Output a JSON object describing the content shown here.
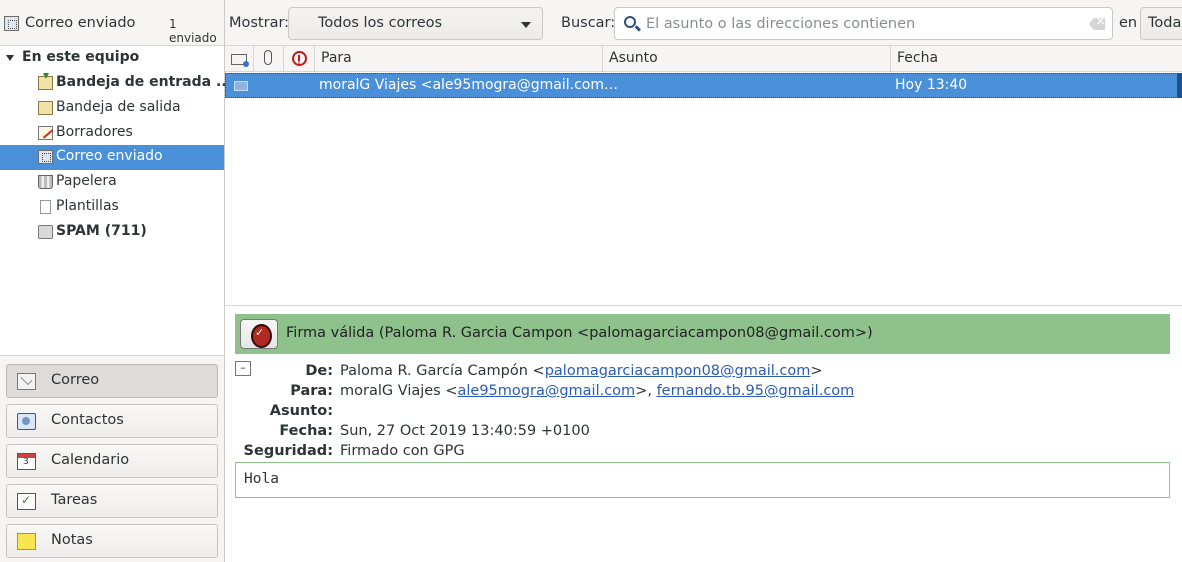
{
  "toolbar": {
    "folder_title": "Correo enviado",
    "folder_count": "1 enviado",
    "show_label": "Mostrar:",
    "show_value": "Todos los correos",
    "search_label": "Buscar:",
    "search_placeholder": "El asunto o las direcciones contienen",
    "in_label": "en",
    "scope_value": "Toda"
  },
  "sidebar": {
    "root_label": "En este equipo",
    "folders": [
      {
        "label": "Bandeja de entrada ...",
        "icon": "inbox-icon"
      },
      {
        "label": "Bandeja de salida",
        "icon": "outbox-icon"
      },
      {
        "label": "Borradores",
        "icon": "drafts-icon"
      },
      {
        "label": "Correo enviado",
        "icon": "sent-icon"
      },
      {
        "label": "Papelera",
        "icon": "trash-icon"
      },
      {
        "label": "Plantillas",
        "icon": "templates-icon"
      },
      {
        "label": "SPAM (711)",
        "icon": "spam-icon"
      }
    ]
  },
  "nav": {
    "items": [
      {
        "label": "Correo",
        "icon": "mail-icon"
      },
      {
        "label": "Contactos",
        "icon": "contacts-icon"
      },
      {
        "label": "Calendario",
        "icon": "calendar-icon"
      },
      {
        "label": "Tareas",
        "icon": "tasks-icon"
      },
      {
        "label": "Notas",
        "icon": "notes-icon"
      }
    ]
  },
  "list": {
    "columns": [
      "Para",
      "Asunto",
      "Fecha"
    ],
    "rows": [
      {
        "to": "moralG Viajes <ale95mogra@gmail.com…",
        "subject": "",
        "date": "Hoy 13:40"
      }
    ]
  },
  "preview": {
    "signature": "Firma válida (Paloma R. Garcia Campon <palomagarciacampon08@gmail.com>)",
    "collapse_symbol": "–",
    "from_label": "De:",
    "from_name": "Paloma R. García Campón <",
    "from_email": "palomagarciacampon08@gmail.com",
    "from_close": ">",
    "to_label": "Para:",
    "to_name": "moralG Viajes <",
    "to_email1": "ale95mogra@gmail.com",
    "to_sep": ">, ",
    "to_email2": "fernando.tb.95@gmail.com",
    "subject_label": "Asunto:",
    "subject_value": "",
    "date_label": "Fecha:",
    "date_value": "Sun, 27 Oct 2019 13:40:59 +0100",
    "security_label": "Seguridad:",
    "security_value": "Firmado con GPG",
    "body": "Hola"
  },
  "colors": {
    "selection": "#4a90d9",
    "signature_banner": "#8ec18b",
    "link": "#2a5bb6"
  }
}
